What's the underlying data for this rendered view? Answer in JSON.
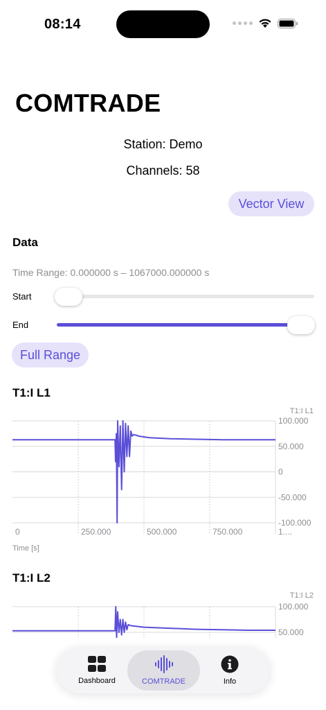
{
  "status": {
    "time": "08:14"
  },
  "page": {
    "title": "COMTRADE",
    "station": "Station: Demo",
    "channels": "Channels: 58",
    "vector_view_label": "Vector View"
  },
  "data_section": {
    "title": "Data",
    "time_range": "Time Range: 0.000000 s – 1067000.000000 s",
    "start_label": "Start",
    "end_label": "End",
    "start_value": 0,
    "end_value": 1,
    "full_range_label": "Full Range"
  },
  "charts": {
    "chart1": {
      "title": "T1:I L1",
      "series_label": "T1:I L1",
      "xlabel": "Time [s]"
    },
    "chart2": {
      "title": "T1:I L2",
      "series_label": "T1:I L2"
    }
  },
  "chart_data": [
    {
      "type": "line",
      "title": "T1:I L1",
      "xlabel": "Time [s]",
      "ylabel": "",
      "series": [
        {
          "name": "T1:I L1",
          "color": "#5b4fd8",
          "x": [
            0,
            380,
            390,
            392,
            395,
            398,
            400,
            405,
            410,
            415,
            420,
            425,
            430,
            435,
            440,
            445,
            450,
            455,
            460,
            470,
            480,
            520,
            600,
            700,
            800,
            900,
            1000
          ],
          "y": [
            63,
            63,
            63,
            20,
            75,
            -100,
            100,
            10,
            90,
            -35,
            100,
            0,
            95,
            30,
            90,
            30,
            80,
            70,
            73,
            72,
            70,
            67,
            65,
            64,
            63,
            63,
            63
          ]
        }
      ],
      "xticks": [
        "0",
        "250.000",
        "500.000",
        "750.000",
        "1...."
      ],
      "yticks": [
        "100.000",
        "50.000",
        "0",
        "-50.000",
        "-100.000"
      ],
      "xlim": [
        0,
        1000
      ],
      "ylim": [
        -100,
        100
      ]
    },
    {
      "type": "line",
      "title": "T1:I L2",
      "series": [
        {
          "name": "T1:I L2",
          "color": "#5b4fd8",
          "x": [
            0,
            380,
            390,
            393,
            396,
            400,
            405,
            410,
            415,
            420,
            425,
            430,
            435,
            440,
            450,
            500,
            600,
            700,
            800,
            900,
            1000
          ],
          "y": [
            53,
            53,
            53,
            100,
            40,
            90,
            50,
            75,
            45,
            75,
            50,
            70,
            55,
            65,
            63,
            60,
            58,
            56,
            55,
            54,
            54
          ]
        }
      ],
      "yticks": [
        "100.000",
        "50.000"
      ],
      "xlim": [
        0,
        1000
      ],
      "ylim": [
        50,
        100
      ]
    }
  ],
  "tabbar": {
    "items": [
      {
        "label": "Dashboard",
        "icon": "grid-icon",
        "selected": false
      },
      {
        "label": "COMTRADE",
        "icon": "waveform-icon",
        "selected": true
      },
      {
        "label": "Info",
        "icon": "info-icon",
        "selected": false
      }
    ],
    "accent": "#5b4fd8"
  }
}
